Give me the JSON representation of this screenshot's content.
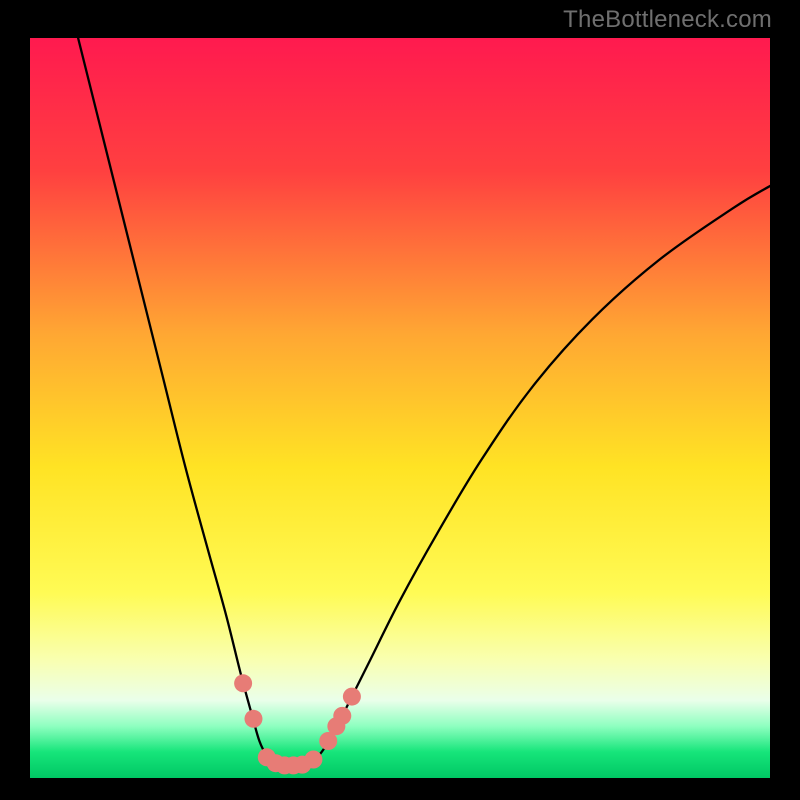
{
  "watermark": {
    "text": "TheBottleneck.com"
  },
  "chart_data": {
    "type": "line",
    "title": "",
    "xlabel": "",
    "ylabel": "",
    "xlim": [
      0,
      100
    ],
    "ylim": [
      0,
      100
    ],
    "grid": false,
    "legend": false,
    "gradient_stops": [
      {
        "offset": 0.0,
        "color": "#ff1a4f"
      },
      {
        "offset": 0.18,
        "color": "#ff4040"
      },
      {
        "offset": 0.4,
        "color": "#ffa733"
      },
      {
        "offset": 0.58,
        "color": "#ffe324"
      },
      {
        "offset": 0.75,
        "color": "#fffb55"
      },
      {
        "offset": 0.84,
        "color": "#f9ffb0"
      },
      {
        "offset": 0.895,
        "color": "#eaffea"
      },
      {
        "offset": 0.93,
        "color": "#8effc0"
      },
      {
        "offset": 0.965,
        "color": "#16e57a"
      },
      {
        "offset": 1.0,
        "color": "#00c764"
      }
    ],
    "series": [
      {
        "name": "bottleneck-curve",
        "color": "#000000",
        "points": [
          {
            "x": 6.5,
            "y": 100.0
          },
          {
            "x": 9.0,
            "y": 90.0
          },
          {
            "x": 12.0,
            "y": 78.0
          },
          {
            "x": 15.0,
            "y": 66.0
          },
          {
            "x": 18.0,
            "y": 54.0
          },
          {
            "x": 21.0,
            "y": 42.0
          },
          {
            "x": 24.0,
            "y": 31.0
          },
          {
            "x": 26.5,
            "y": 22.0
          },
          {
            "x": 28.5,
            "y": 14.0
          },
          {
            "x": 30.0,
            "y": 8.5
          },
          {
            "x": 31.0,
            "y": 5.0
          },
          {
            "x": 32.0,
            "y": 3.0
          },
          {
            "x": 33.0,
            "y": 2.0
          },
          {
            "x": 34.5,
            "y": 1.5
          },
          {
            "x": 36.0,
            "y": 1.5
          },
          {
            "x": 37.5,
            "y": 2.0
          },
          {
            "x": 39.0,
            "y": 3.0
          },
          {
            "x": 41.0,
            "y": 6.0
          },
          {
            "x": 43.0,
            "y": 10.0
          },
          {
            "x": 46.0,
            "y": 16.0
          },
          {
            "x": 50.0,
            "y": 24.0
          },
          {
            "x": 55.0,
            "y": 33.0
          },
          {
            "x": 61.0,
            "y": 43.0
          },
          {
            "x": 68.0,
            "y": 53.0
          },
          {
            "x": 76.0,
            "y": 62.0
          },
          {
            "x": 85.0,
            "y": 70.0
          },
          {
            "x": 95.0,
            "y": 77.0
          },
          {
            "x": 100.0,
            "y": 80.0
          }
        ]
      }
    ],
    "markers": {
      "name": "highlight-dots",
      "color": "#e77c76",
      "radius": 9,
      "points": [
        {
          "x": 28.8,
          "y": 12.8
        },
        {
          "x": 30.2,
          "y": 8.0
        },
        {
          "x": 32.0,
          "y": 2.8
        },
        {
          "x": 33.2,
          "y": 2.0
        },
        {
          "x": 34.4,
          "y": 1.7
        },
        {
          "x": 35.6,
          "y": 1.7
        },
        {
          "x": 36.8,
          "y": 1.8
        },
        {
          "x": 38.3,
          "y": 2.5
        },
        {
          "x": 40.3,
          "y": 5.0
        },
        {
          "x": 41.4,
          "y": 7.0
        },
        {
          "x": 42.2,
          "y": 8.4
        },
        {
          "x": 43.5,
          "y": 11.0
        }
      ]
    }
  }
}
